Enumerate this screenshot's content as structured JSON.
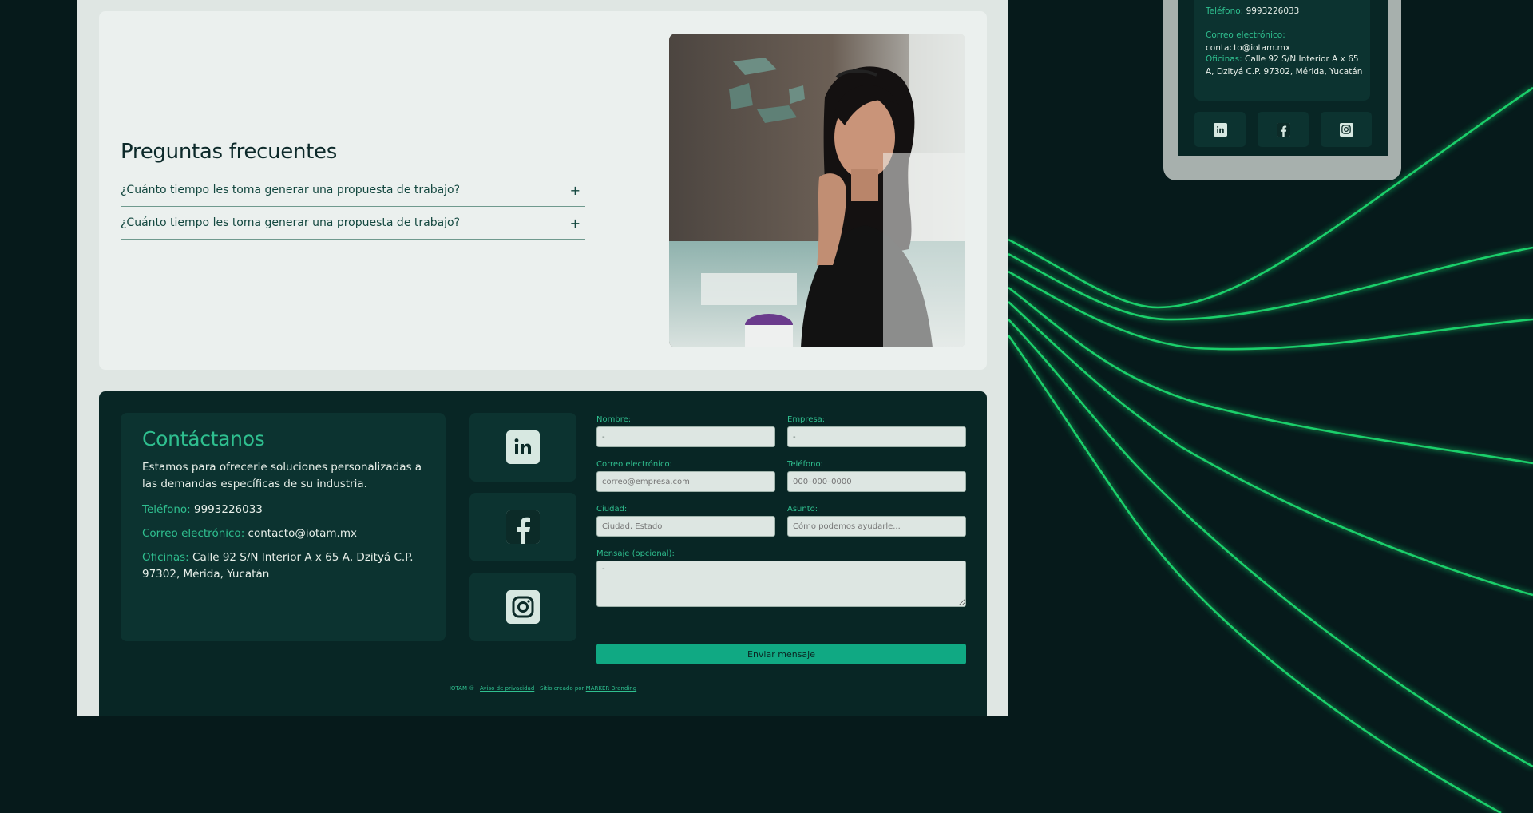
{
  "faq": {
    "title": "Preguntas frecuentes",
    "items": [
      {
        "question": "¿Cuánto tiempo les toma generar una propuesta de trabajo?",
        "toggle": "+"
      },
      {
        "question": "¿Cuánto tiempo les toma generar una propuesta de trabajo?",
        "toggle": "+"
      }
    ]
  },
  "contact": {
    "title": "Contáctanos",
    "description": "Estamos para ofrecerle soluciones personalizadas a las demandas específicas de su industria.",
    "phone_label": "Teléfono:",
    "phone_value": "9993226033",
    "email_label": "Correo electrónico:",
    "email_value": "contacto@iotam.mx",
    "office_label": "Oficinas:",
    "office_value": "Calle 92 S/N Interior A x 65 A, Dzityá C.P. 97302, Mérida, Yucatán",
    "social_icons": [
      "linkedin-icon",
      "facebook-icon",
      "instagram-icon"
    ]
  },
  "form": {
    "name_label": "Nombre:",
    "name_value": "-",
    "company_label": "Empresa:",
    "company_value": "-",
    "email_label": "Correo electrónico:",
    "email_placeholder": "correo@empresa.com",
    "phone_label": "Teléfono:",
    "phone_placeholder": "000–000–0000",
    "city_label": "Ciudad:",
    "city_placeholder": "Ciudad, Estado",
    "subject_label": "Asunto:",
    "subject_placeholder": "Cómo podemos ayudarle...",
    "message_label": "Mensaje (opcional):",
    "message_value": "-",
    "submit_label": "Enviar mensaje"
  },
  "footer": {
    "brand": "IOTAM ® |",
    "privacy_link": "Aviso de privacidad",
    "separator": "| Sitio creado por",
    "agency_link": "MARKER Branding"
  },
  "phone_preview": {
    "phone_label": "Teléfono:",
    "phone_value": "9993226033",
    "email_label": "Correo electrónico:",
    "email_value": "contacto@iotam.mx",
    "office_label": "Oficinas:",
    "office_value": "Calle 92 S/N Interior A x 65 A, Dzityá C.P. 97302, Mérida, Yucatán"
  },
  "colors": {
    "background": "#061a1b",
    "accent": "#2fbf8f",
    "button": "#10a983",
    "card_dark": "#082625",
    "glow_lines": "#1ee07a"
  }
}
